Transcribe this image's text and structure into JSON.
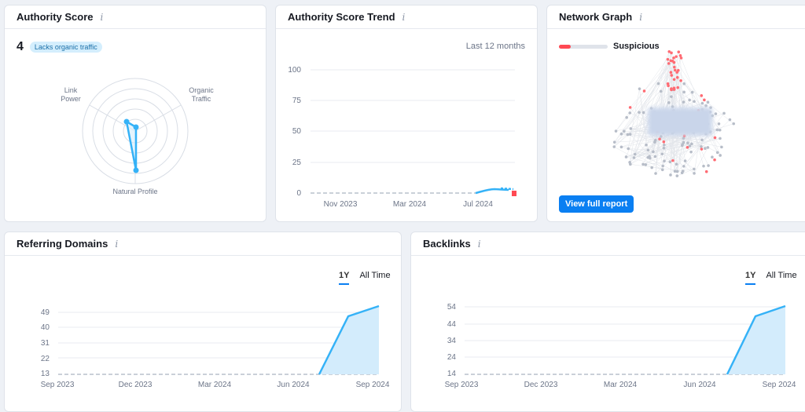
{
  "authority_score": {
    "title": "Authority Score",
    "info_icon": "i",
    "score": "4",
    "badge": "Lacks organic traffic",
    "radar_labels": {
      "link_power": [
        "Link",
        "Power"
      ],
      "organic_traffic": [
        "Organic",
        "Traffic"
      ],
      "natural_profile": "Natural Profile"
    }
  },
  "trend": {
    "title": "Authority Score Trend",
    "info_icon": "i",
    "range": "Last 12 months",
    "y_ticks": [
      "100",
      "75",
      "50",
      "25",
      "0"
    ],
    "x_ticks": [
      "Nov 2023",
      "Mar 2024",
      "Jul 2024"
    ]
  },
  "network": {
    "title": "Network Graph",
    "info_icon": "i",
    "status": "Suspicious",
    "button": "View full report"
  },
  "referring_domains": {
    "title": "Referring Domains",
    "info_icon": "i",
    "toggle": [
      "1Y",
      "All Time"
    ]
  },
  "backlinks": {
    "title": "Backlinks",
    "info_icon": "i",
    "toggle": [
      "1Y",
      "All Time"
    ]
  },
  "colors": {
    "accent": "#0a7ff2",
    "line": "#35b2f7",
    "fill": "#d3ecfc",
    "danger": "#ff4953"
  },
  "chart_data": [
    {
      "type": "line",
      "x_ticks": [
        "Nov 2023",
        "Mar 2024",
        "Jul 2024"
      ],
      "y_ticks": [
        0,
        25,
        50,
        75,
        100
      ],
      "ylim": [
        0,
        100
      ],
      "values": [
        0,
        0,
        0,
        0,
        0,
        0,
        0,
        0,
        0,
        0,
        0,
        0,
        3,
        4
      ]
    },
    {
      "type": "area",
      "x_ticks": [
        "Sep 2023",
        "Dec 2023",
        "Mar 2024",
        "Jun 2024",
        "Sep 2024"
      ],
      "y_ticks": [
        13,
        22,
        31,
        40,
        49
      ],
      "ylim": [
        13,
        53
      ],
      "values": [
        13,
        13,
        13,
        13,
        13,
        13,
        13,
        13,
        13,
        13,
        13,
        13,
        13,
        13,
        13,
        13,
        13,
        13,
        13,
        13,
        13,
        13,
        13,
        13,
        13,
        13,
        13,
        13,
        13,
        13,
        13,
        13,
        13,
        13,
        13,
        13,
        13,
        13,
        13,
        13,
        13,
        13,
        13,
        13,
        13,
        13,
        13,
        13,
        13,
        13,
        13,
        13,
        13,
        13,
        13,
        13,
        13,
        13,
        13,
        13,
        13,
        13,
        13,
        13,
        13,
        13,
        13,
        13,
        13,
        13,
        13,
        13,
        13,
        13,
        13,
        13,
        13,
        13,
        13,
        13,
        13,
        13,
        13,
        13,
        13,
        13,
        13,
        13,
        13,
        47,
        49,
        53
      ],
      "segment_points": [
        [
          0,
          13
        ],
        [
          0.766,
          13
        ],
        [
          0.905,
          47
        ],
        [
          1,
          53
        ]
      ]
    },
    {
      "type": "area",
      "x_ticks": [
        "Sep 2023",
        "Dec 2023",
        "Mar 2024",
        "Jun 2024",
        "Sep 2024"
      ],
      "y_ticks": [
        14,
        24,
        34,
        44,
        54
      ],
      "ylim": [
        14,
        54
      ],
      "segment_points": [
        [
          0,
          14
        ],
        [
          0.766,
          14
        ],
        [
          0.905,
          50
        ],
        [
          1,
          55
        ]
      ]
    }
  ]
}
